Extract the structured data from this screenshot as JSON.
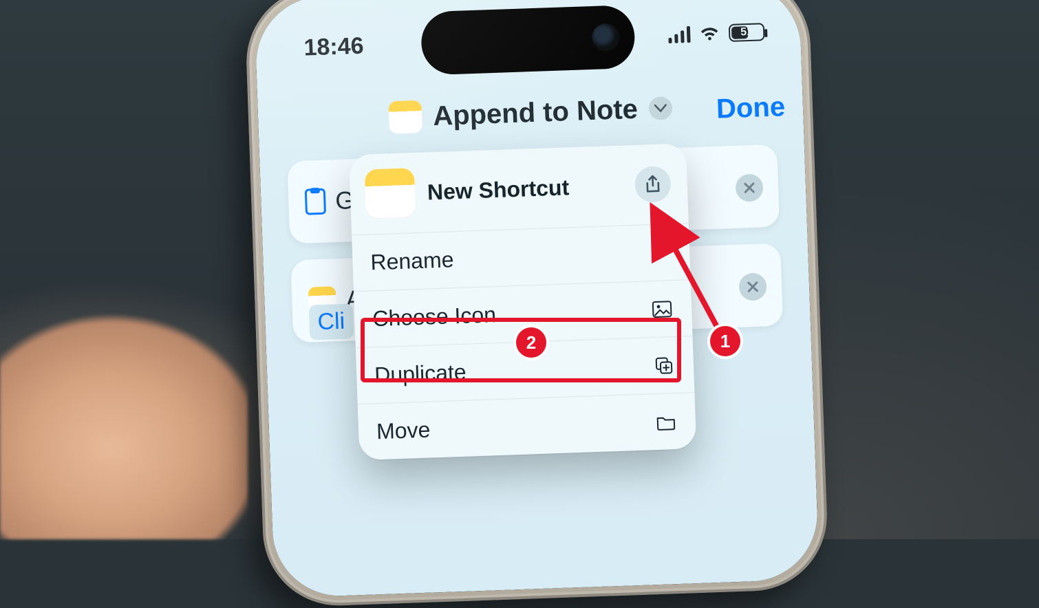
{
  "status": {
    "time": "18:46",
    "battery_pct": "51",
    "battery_fill_pct": 51
  },
  "header": {
    "title": "Append to Note",
    "done": "Done"
  },
  "bg_cards": {
    "card1_letter": "G",
    "card2_letter": "A",
    "clip_label": "Cli"
  },
  "popover": {
    "title": "New Shortcut",
    "items": {
      "rename": "Rename",
      "choose_icon": "Choose Icon",
      "duplicate": "Duplicate",
      "move": "Move"
    }
  },
  "annotations": {
    "badge1": "1",
    "badge2": "2"
  }
}
